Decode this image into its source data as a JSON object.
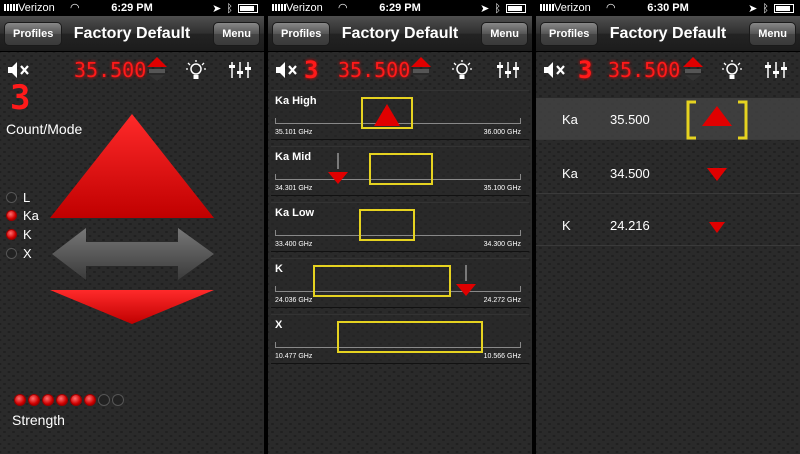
{
  "status": {
    "carrier": "Verizon",
    "time_p1": "6:29 PM",
    "time_p2": "6:29 PM",
    "time_p3": "6:30 PM"
  },
  "nav": {
    "left_button": "Profiles",
    "title": "Factory Default",
    "right_button": "Menu"
  },
  "toolbar": {
    "count_digit": "3",
    "frequency": "35.500"
  },
  "main": {
    "count_mode_label": "Count/Mode",
    "bands": [
      {
        "label": "L",
        "active": false
      },
      {
        "label": "Ka",
        "active": true
      },
      {
        "label": "K",
        "active": true
      },
      {
        "label": "X",
        "active": false
      }
    ],
    "strength_label": "Strength",
    "strength_level": 6,
    "strength_max": 8
  },
  "bands_view": [
    {
      "name": "Ka High",
      "low": "35.101 GHz",
      "high": "36.000 GHz"
    },
    {
      "name": "Ka Mid",
      "low": "34.301 GHz",
      "high": "35.100 GHz"
    },
    {
      "name": "Ka Low",
      "low": "33.400 GHz",
      "high": "34.300 GHz"
    },
    {
      "name": "K",
      "low": "24.036 GHz",
      "high": "24.272 GHz"
    },
    {
      "name": "X",
      "low": "10.477 GHz",
      "high": "10.566 GHz"
    }
  ],
  "alert_list": [
    {
      "band": "Ka",
      "freq": "35.500"
    },
    {
      "band": "Ka",
      "freq": "34.500"
    },
    {
      "band": "K",
      "freq": "24.216"
    }
  ],
  "colors": {
    "alert_red": "#e00000",
    "window_yellow": "#e6d320"
  },
  "icons": {
    "mute": "speaker-mute-icon",
    "light": "bulb-icon",
    "settings": "sliders-icon"
  }
}
